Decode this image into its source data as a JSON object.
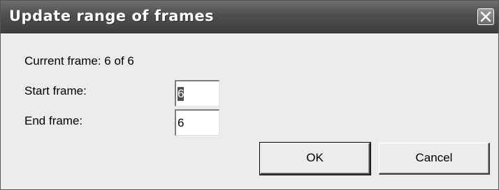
{
  "window": {
    "title": "Update range of frames",
    "close_icon": "close-icon"
  },
  "dialog": {
    "current_frame_text": "Current frame: 6 of 6",
    "start_frame_label": "Start frame:",
    "start_frame_value": "6",
    "end_frame_label": "End frame:",
    "end_frame_value": "6",
    "ok_label": "OK",
    "cancel_label": "Cancel"
  },
  "colors": {
    "titlebar": "#4f4f4f",
    "dialog_background": "#ececec",
    "selection": "#505050"
  }
}
